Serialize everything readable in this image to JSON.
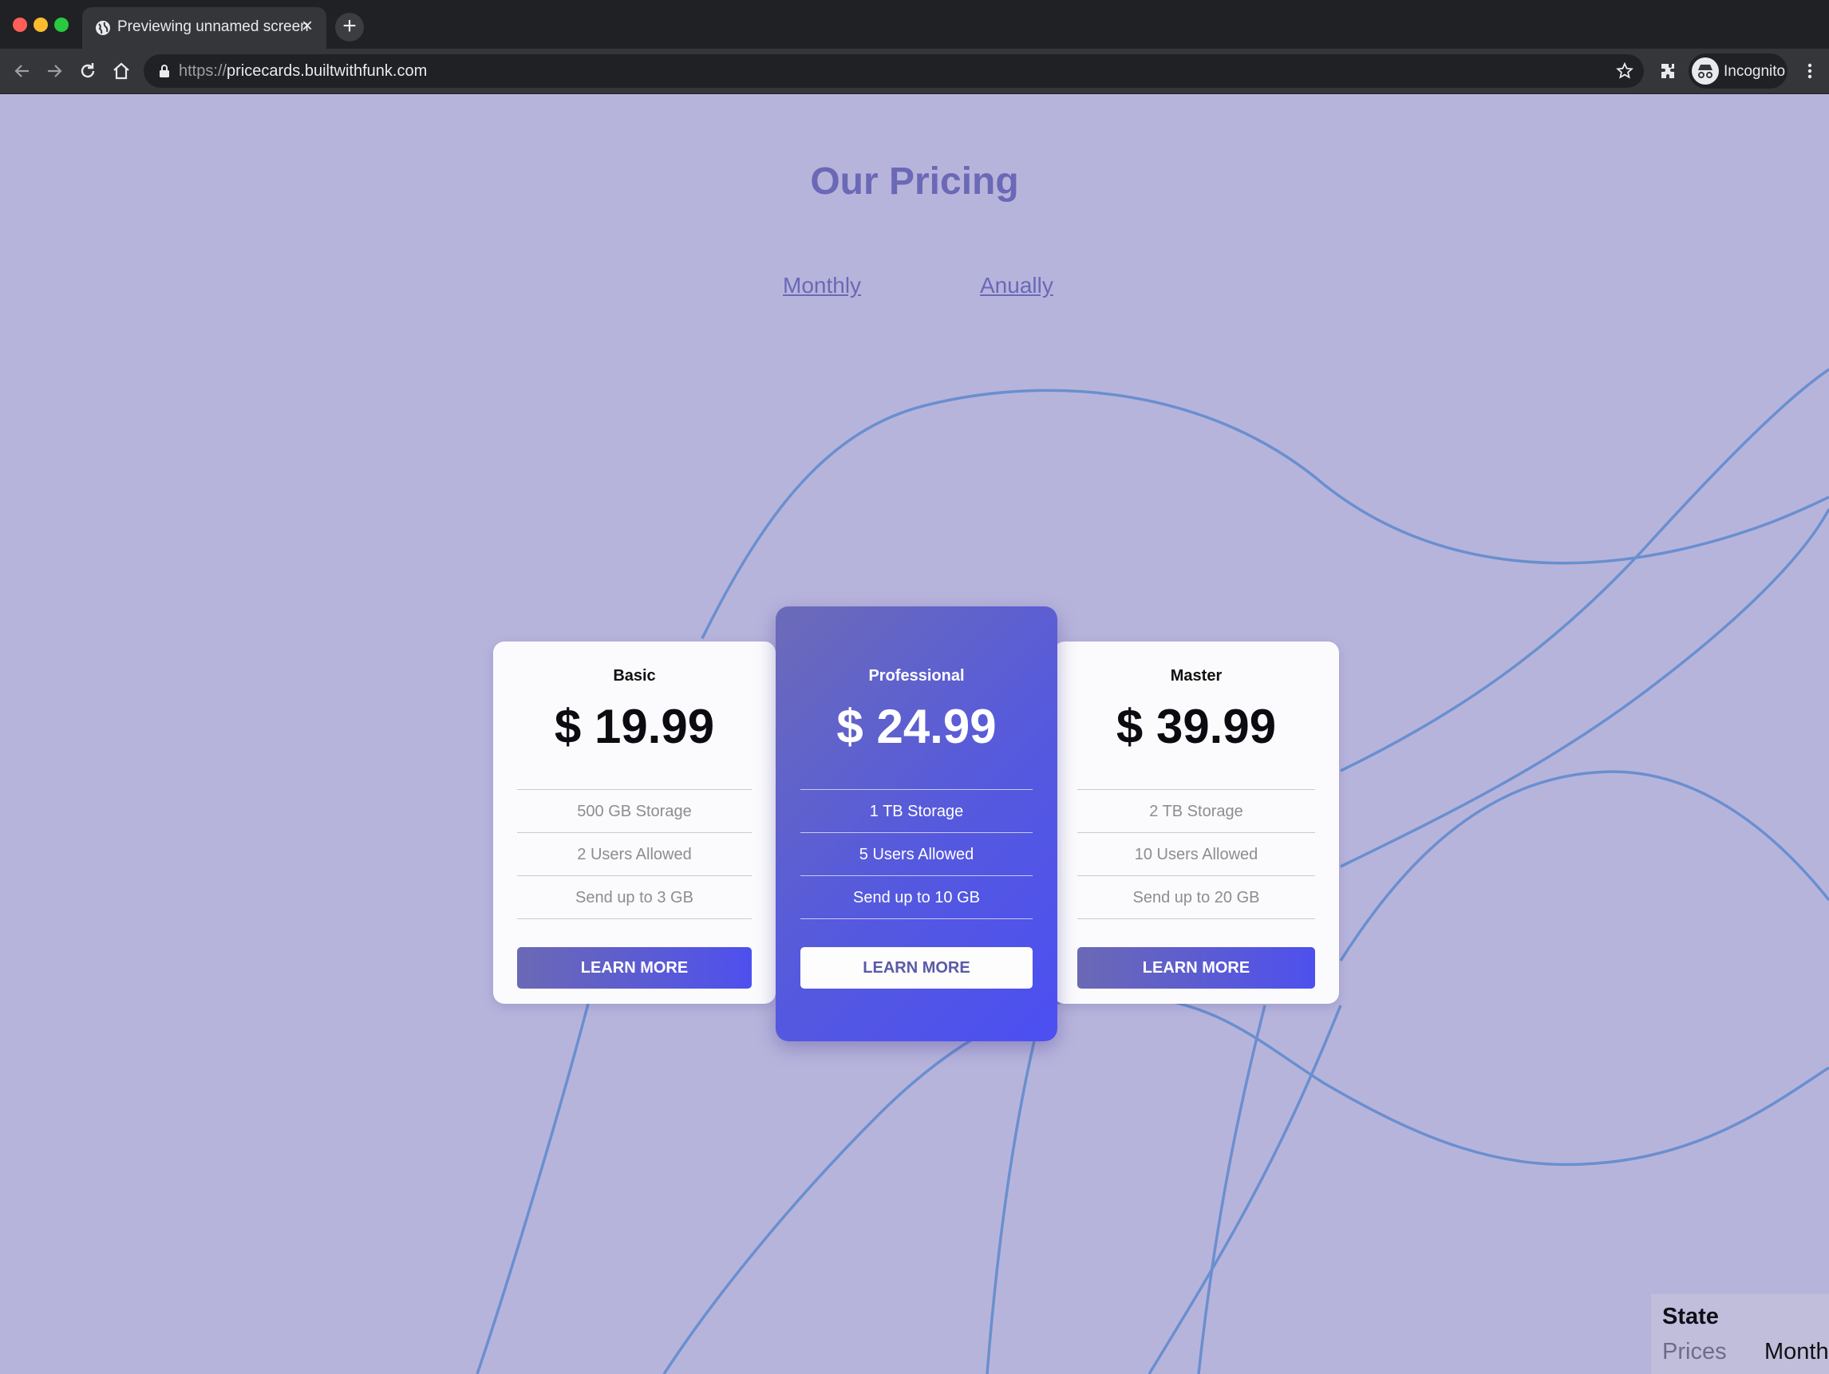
{
  "browser": {
    "tab_title": "Previewing unnamed screen",
    "url_protocol": "https://",
    "url_host": "pricecards.builtwithfunk.com",
    "profile_label": "Incognito"
  },
  "page": {
    "title": "Our Pricing",
    "toggle_monthly": "Monthly",
    "toggle_annually": "Anually",
    "line_color": "#6a8fcf",
    "background_color": "#b7b4dc",
    "accent_color": "#5053ea"
  },
  "plans": [
    {
      "name": "Basic",
      "price": "$ 19.99",
      "features": [
        "500 GB Storage",
        "2 Users Allowed",
        "Send up to 3 GB"
      ],
      "cta": "LEARN MORE"
    },
    {
      "name": "Professional",
      "price": "$ 24.99",
      "features": [
        "1 TB Storage",
        "5 Users Allowed",
        "Send up to 10 GB"
      ],
      "cta": "LEARN MORE"
    },
    {
      "name": "Master",
      "price": "$ 39.99",
      "features": [
        "2 TB Storage",
        "10 Users Allowed",
        "Send up to 20 GB"
      ],
      "cta": "LEARN MORE"
    }
  ],
  "state_panel": {
    "title": "State",
    "key": "Prices",
    "value": "Month"
  }
}
